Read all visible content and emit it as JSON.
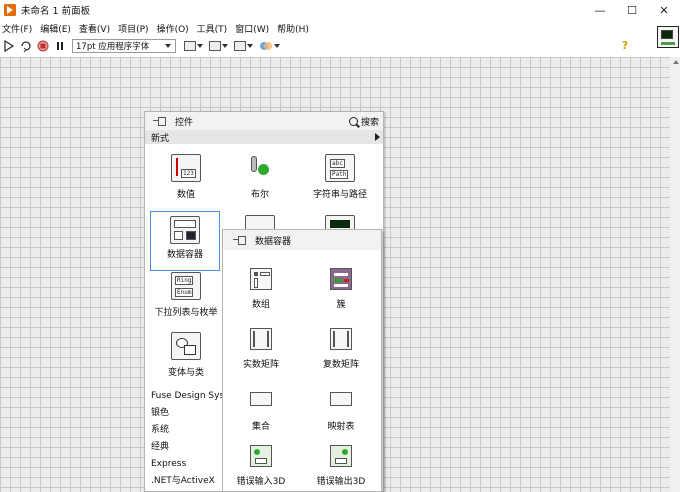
{
  "window": {
    "title": "未命名 1 前面板",
    "minimize": "—",
    "maximize": "☐",
    "close": "✕"
  },
  "menu": [
    "文件(F)",
    "编辑(E)",
    "查看(V)",
    "项目(P)",
    "操作(O)",
    "工具(T)",
    "窗口(W)",
    "帮助(H)"
  ],
  "toolbar": {
    "font": "17pt 应用程序字体",
    "icons": [
      "run-arrow-icon",
      "run-continuously-icon",
      "abort-icon",
      "pause-icon",
      "align-icon",
      "distribute-icon",
      "resize-icon",
      "reorder-icon"
    ],
    "help": "?"
  },
  "palette": {
    "title": "控件",
    "search": "搜索",
    "category": "新式",
    "tiles": [
      "数值",
      "布尔",
      "字符串与路径",
      "数据容器",
      "下拉列表与枚举",
      "变体与类"
    ],
    "categories": [
      "Fuse Design System",
      "银色",
      "系统",
      "经典",
      "Express",
      ".NET与ActiveX"
    ]
  },
  "submenu": {
    "title": "数据容器",
    "items": [
      "数组",
      "簇",
      "实数矩阵",
      "复数矩阵",
      "集合",
      "映射表",
      "错误输入3D",
      "错误输出3D"
    ]
  },
  "glyph_text": {
    "numeric": "123",
    "string": "abc",
    "path": "Path",
    "ring": "Ring",
    "enum": "Enum"
  }
}
